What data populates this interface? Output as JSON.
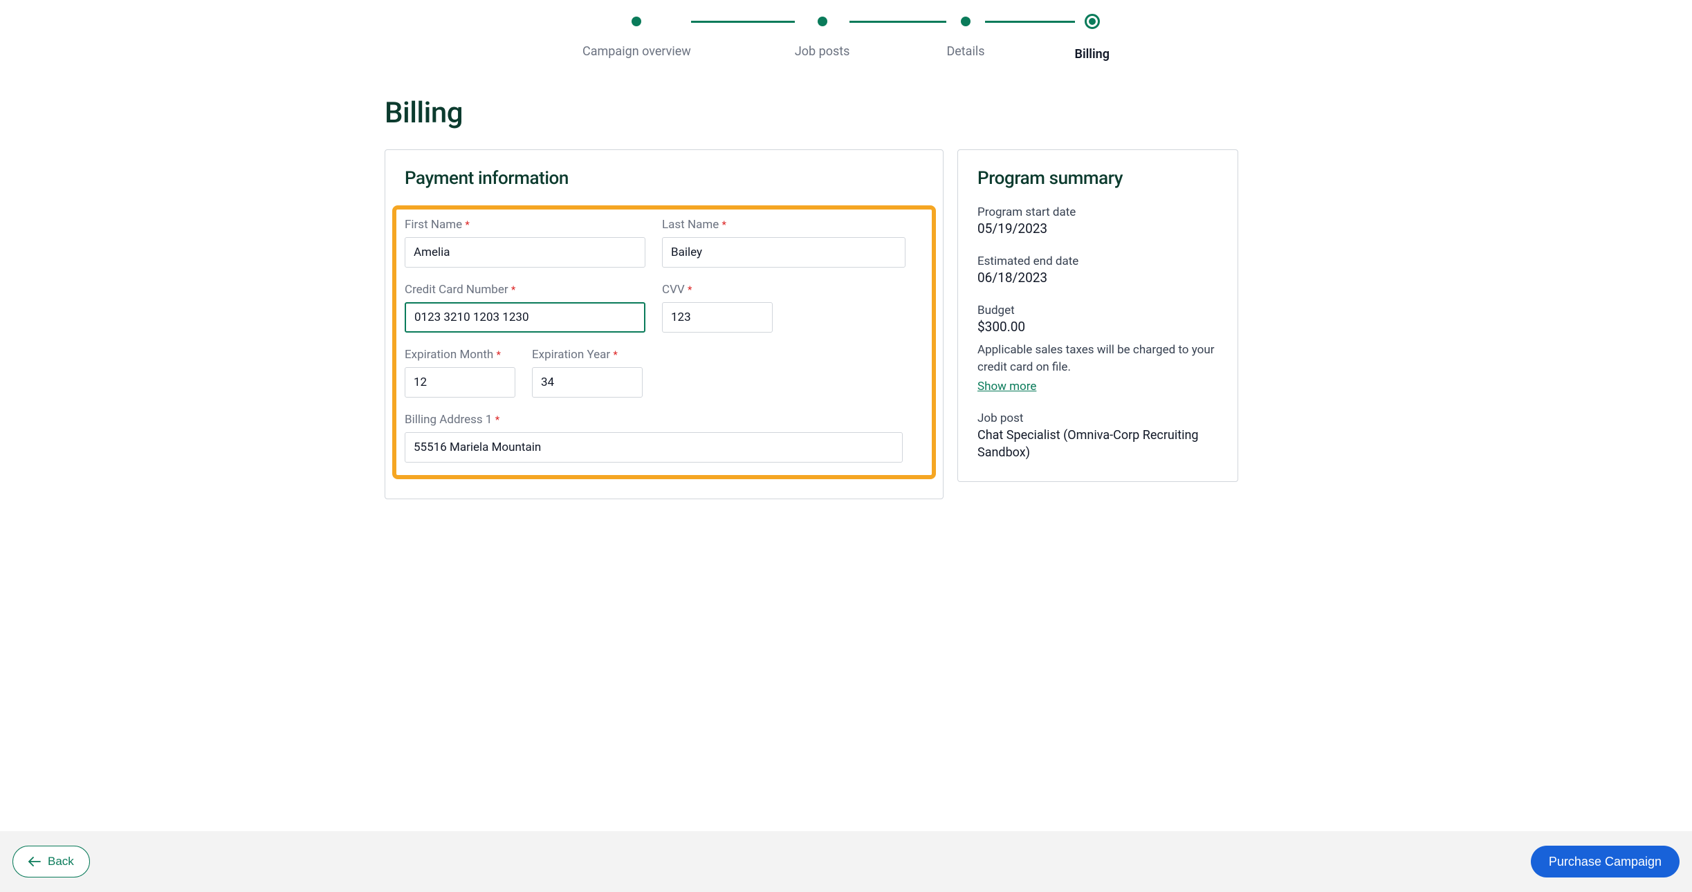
{
  "stepper": {
    "steps": [
      {
        "label": "Campaign overview"
      },
      {
        "label": "Job posts"
      },
      {
        "label": "Details"
      },
      {
        "label": "Billing"
      }
    ]
  },
  "page_title": "Billing",
  "payment": {
    "title": "Payment information",
    "first_name": {
      "label": "First Name",
      "value": "Amelia"
    },
    "last_name": {
      "label": "Last Name",
      "value": "Bailey"
    },
    "cc_number": {
      "label": "Credit Card Number",
      "value": "0123 3210 1203 1230 "
    },
    "cvv": {
      "label": "CVV",
      "value": "123"
    },
    "exp_month": {
      "label": "Expiration Month",
      "value": "12"
    },
    "exp_year": {
      "label": "Expiration Year",
      "value": "34"
    },
    "address1": {
      "label": "Billing Address 1",
      "value": "55516 Mariela Mountain"
    }
  },
  "summary": {
    "title": "Program summary",
    "start_date": {
      "label": "Program start date",
      "value": "05/19/2023"
    },
    "end_date": {
      "label": "Estimated end date",
      "value": "06/18/2023"
    },
    "budget": {
      "label": "Budget",
      "value": "$300.00"
    },
    "tax_note": "Applicable sales taxes will be charged to your credit card on file.",
    "show_more": "Show more",
    "job_post": {
      "label": "Job post",
      "value": "Chat Specialist (Omniva-Corp Recruiting Sandbox)"
    }
  },
  "footer": {
    "back_label": "Back",
    "purchase_label": "Purchase Campaign"
  }
}
